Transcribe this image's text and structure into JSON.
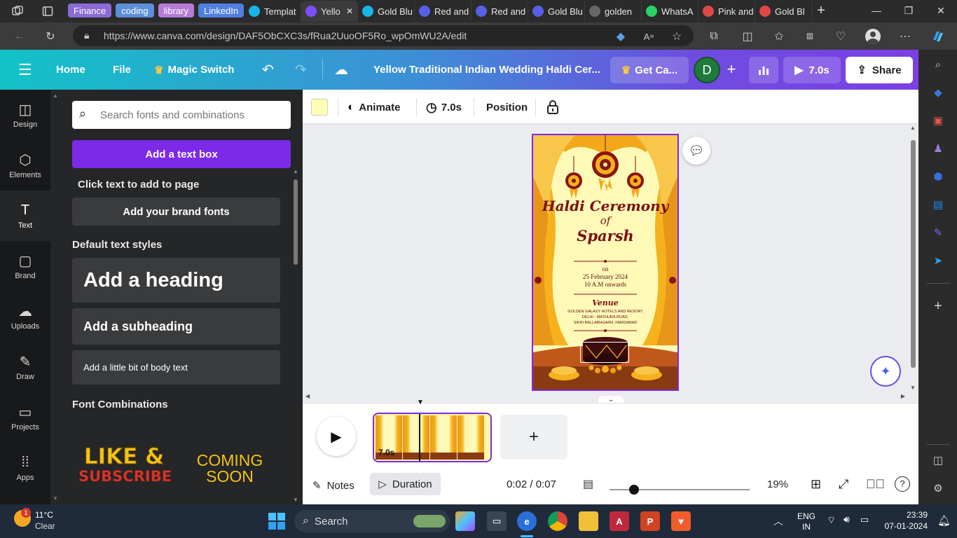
{
  "browser": {
    "tab_groups": [
      {
        "label": "Finance",
        "color": "#8a6bd6"
      },
      {
        "label": "coding",
        "color": "#5b8fd9"
      },
      {
        "label": "library",
        "color": "#b67bd6"
      },
      {
        "label": "LinkedIn",
        "color": "#4f7fe0"
      }
    ],
    "tabs": [
      {
        "label": "Templat",
        "icon": "canva-icon",
        "color": "#1ab5e8"
      },
      {
        "label": "Yello",
        "icon": "video-icon",
        "color": "#7c4dff",
        "active": true
      },
      {
        "label": "Gold Blu",
        "icon": "canva-icon",
        "color": "#1ab5e8"
      },
      {
        "label": "Red and",
        "icon": "doc-icon",
        "color": "#5660e6"
      },
      {
        "label": "Red and",
        "icon": "doc-icon",
        "color": "#5660e6"
      },
      {
        "label": "Gold Blu",
        "icon": "doc-icon",
        "color": "#5660e6"
      },
      {
        "label": "golden",
        "icon": "search-icon",
        "color": "#666"
      },
      {
        "label": "WhatsA",
        "icon": "whatsapp-icon",
        "color": "#25d366"
      },
      {
        "label": "Pink and",
        "icon": "pdf-icon",
        "color": "#e04848"
      },
      {
        "label": "Gold Bl",
        "icon": "pdf-icon",
        "color": "#e04848"
      }
    ],
    "url": "https://www.canva.com/design/DAF5ObCXC3s/fRua2UuoOF5Ro_wpOmWU2A/edit"
  },
  "canva_header": {
    "home": "Home",
    "file": "File",
    "magic_switch": "Magic Switch",
    "title": "Yellow Traditional Indian Wedding Haldi Cer...",
    "get_canva": "Get Ca...",
    "avatar_letter": "D",
    "play_duration": "7.0s",
    "share": "Share"
  },
  "rail": [
    {
      "label": "Design",
      "icon": "design-icon"
    },
    {
      "label": "Elements",
      "icon": "elements-icon"
    },
    {
      "label": "Text",
      "icon": "text-icon",
      "selected": true
    },
    {
      "label": "Brand",
      "icon": "brand-icon"
    },
    {
      "label": "Uploads",
      "icon": "upload-icon"
    },
    {
      "label": "Draw",
      "icon": "draw-icon"
    },
    {
      "label": "Projects",
      "icon": "folder-icon"
    },
    {
      "label": "Apps",
      "icon": "apps-icon"
    }
  ],
  "text_panel": {
    "search_placeholder": "Search fonts and combinations",
    "add_text_box": "Add a text box",
    "click_text_hint": "Click text to add to page",
    "brand_fonts": "Add your brand fonts",
    "default_styles_heading": "Default text styles",
    "heading": "Add a heading",
    "subheading": "Add a subheading",
    "body": "Add a little bit of body text",
    "font_combinations_heading": "Font Combinations",
    "combo1_line1": "LIKE &",
    "combo1_line2": "SUBSCRIBE",
    "combo2_line1": "COMING",
    "combo2_line2": "SOON"
  },
  "context_toolbar": {
    "swatch_color": "#ffffb3",
    "animate": "Animate",
    "duration": "7.0s",
    "position": "Position"
  },
  "invitation": {
    "title_line1": "Haldi Ceremony",
    "title_line2": "of",
    "title_line3": "Sparsh",
    "on": "on",
    "date": "25 February 2024",
    "time": "10 A.M onwards",
    "venue_label": "Venue",
    "venue_line1": "GOLDEN GALAXY HOTELS AND RESORT",
    "venue_line2": "DELHI - MATHURA ROAD,",
    "venue_line3": "SIKRI BALLABHGARH, FARIDABAD"
  },
  "timeline": {
    "clip_duration": "7.0s",
    "notes": "Notes",
    "duration": "Duration",
    "time": "0:02 / 0:07",
    "zoom_percent": 19,
    "zoom_label": "19%"
  },
  "taskbar": {
    "weather_temp": "11°C",
    "weather_desc": "Clear",
    "notification_count": "1",
    "search": "Search",
    "lang1": "ENG",
    "lang2": "IN",
    "clock_time": "23:39",
    "clock_date": "07-01-2024"
  }
}
